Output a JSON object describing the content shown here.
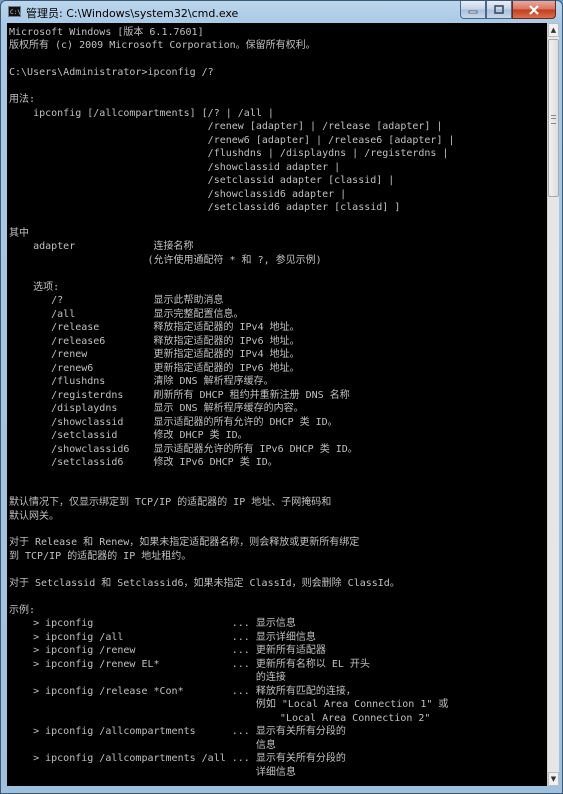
{
  "window": {
    "title": "管理员: C:\\Windows\\system32\\cmd.exe",
    "icon": "C:\\",
    "buttons": {
      "minimize": "minimize-icon",
      "maximize": "maximize-icon",
      "close": "close-icon"
    }
  },
  "console": {
    "text_color": "#c0c0c0",
    "background_color": "#000000",
    "lines": [
      "Microsoft Windows [版本 6.1.7601]",
      "版权所有 (c) 2009 Microsoft Corporation。保留所有权利。",
      "C:\\Users\\Administrator>ipconfig /?",
      "用法:",
      "    ipconfig [/allcompartments] [/? | /all |",
      "                                 /renew [adapter] | /release [adapter] |",
      "                                 /renew6 [adapter] | /release6 [adapter] |",
      "                                 /flushdns | /displaydns | /registerdns |",
      "                                 /showclassid adapter |",
      "                                 /setclassid adapter [classid] |",
      "                                 /showclassid6 adapter |",
      "                                 /setclassid6 adapter [classid] ]",
      "其中",
      "    adapter             连接名称",
      "                       (允许使用通配符 * 和 ?, 参见示例)",
      "    选项:",
      "       /?               显示此帮助消息",
      "       /all             显示完整配置信息。",
      "       /release         释放指定适配器的 IPv4 地址。",
      "       /release6        释放指定适配器的 IPv6 地址。",
      "       /renew           更新指定适配器的 IPv4 地址。",
      "       /renew6          更新指定适配器的 IPv6 地址。",
      "       /flushdns        清除 DNS 解析程序缓存。",
      "       /registerdns     刷新所有 DHCP 租约并重新注册 DNS 名称",
      "       /displaydns      显示 DNS 解析程序缓存的内容。",
      "       /showclassid     显示适配器的所有允许的 DHCP 类 ID。",
      "       /setclassid      修改 DHCP 类 ID。",
      "       /showclassid6    显示适配器允许的所有 IPv6 DHCP 类 ID。",
      "       /setclassid6     修改 IPv6 DHCP 类 ID。",
      "默认情况下，仅显示绑定到 TCP/IP 的适配器的 IP 地址、子网掩码和",
      "默认网关。",
      "对于 Release 和 Renew，如果未指定适配器名称，则会释放或更新所有绑定",
      "到 TCP/IP 的适配器的 IP 地址租约。",
      "对于 Setclassid 和 Setclassid6，如果未指定 ClassId，则会删除 ClassId。",
      "示例:",
      "    > ipconfig                       ... 显示信息",
      "    > ipconfig /all                  ... 显示详细信息",
      "    > ipconfig /renew                ... 更新所有适配器",
      "    > ipconfig /renew EL*            ... 更新所有名称以 EL 开头",
      "                                         的连接",
      "    > ipconfig /release *Con*        ... 释放所有匹配的连接，",
      "                                         例如 \"Local Area Connection 1\" 或",
      "                                             \"Local Area Connection 2\"",
      "    > ipconfig /allcompartments      ... 显示有关所有分段的",
      "                                         信息",
      "    > ipconfig /allcompartments /all ... 显示有关所有分段的",
      "                                         详细信息"
    ]
  }
}
